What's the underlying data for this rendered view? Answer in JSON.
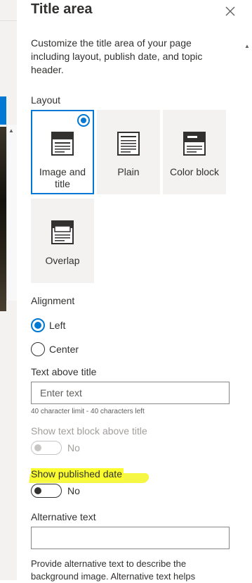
{
  "panel": {
    "title": "Title area",
    "description": "Customize the title area of your page including layout, publish date, and topic header."
  },
  "layout": {
    "label": "Layout",
    "options": [
      {
        "label": "Image and title",
        "icon": "image-and-title-layout-icon",
        "selected": true
      },
      {
        "label": "Plain",
        "icon": "plain-layout-icon",
        "selected": false
      },
      {
        "label": "Color block",
        "icon": "color-block-layout-icon",
        "selected": false
      },
      {
        "label": "Overlap",
        "icon": "overlap-layout-icon",
        "selected": false
      }
    ]
  },
  "alignment": {
    "label": "Alignment",
    "options": [
      {
        "label": "Left",
        "checked": true
      },
      {
        "label": "Center",
        "checked": false
      }
    ]
  },
  "text_above_title": {
    "label": "Text above title",
    "placeholder": "Enter text",
    "hint": "40 character limit - 40 characters left"
  },
  "show_text_block": {
    "label": "Show text block above title",
    "state": "No",
    "disabled": true
  },
  "show_published_date": {
    "label": "Show published date",
    "state": "No"
  },
  "alternative_text": {
    "label": "Alternative text",
    "value": "",
    "help": "Provide alternative text to describe the background image. Alternative text helps"
  },
  "colors": {
    "accent": "#0078d4",
    "highlight": "#f4f73a",
    "tile_bg": "#f3f2f1"
  }
}
